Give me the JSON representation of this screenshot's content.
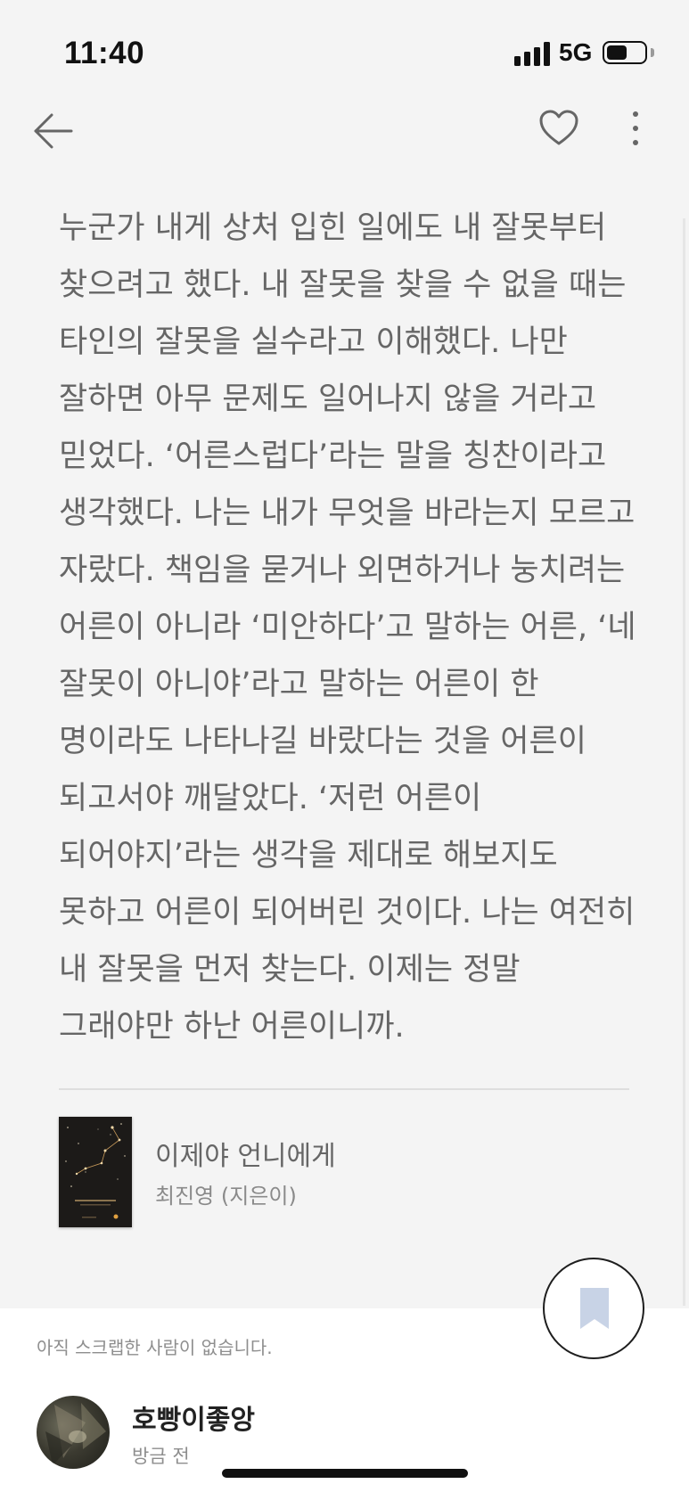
{
  "status_bar": {
    "time": "11:40",
    "network": "5G",
    "battery_level": 0.55,
    "signal_bars": 4
  },
  "top_bar": {
    "back_icon": "arrow-left-icon",
    "like_icon": "heart-outline-icon",
    "more_icon": "vertical-ellipsis-icon"
  },
  "quote": {
    "text": "누군가 내게 상처 입힌 일에도 내 잘못부터 찾으려고 했다. 내 잘못을 찾을 수 없을 때는 타인의 잘못을 실수라고 이해했다. 나만 잘하면 아무 문제도 일어나지 않을 거라고 믿었다. ‘어른스럽다’라는 말을 칭찬이라고 생각했다. 나는 내가 무엇을 바라는지 모르고 자랐다. 책임을 묻거나 외면하거나 눙치려는 어른이 아니라 ‘미안하다’고 말하는 어른, ‘네 잘못이 아니야’라고 말하는 어른이 한 명이라도 나타나길 바랐다는 것을 어른이 되고서야 깨달았다. ‘저런 어른이 되어야지’라는 생각을 제대로 해보지도 못하고 어른이 되어버린 것이다. 나는 여전히 내 잘못을 먼저 찾는다. 이제는 정말 그래야만 하난 어른이니까."
  },
  "book": {
    "title": "이제야 언니에게",
    "author": "최진영 (지은이)"
  },
  "scrap": {
    "note": "아직 스크랩한 사람이 없습니다.",
    "bookmark_icon": "bookmark-icon"
  },
  "user": {
    "name": "호빵이좋앙",
    "time": "방금 전"
  },
  "colors": {
    "background": "#f4f4f4",
    "text": "#666666",
    "bookmark_fill": "#c8d3e6",
    "panel": "#ffffff"
  }
}
